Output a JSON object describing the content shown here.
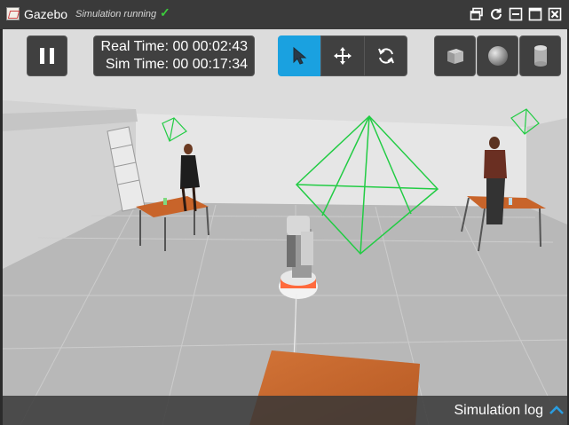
{
  "app": {
    "title": "Gazebo",
    "status": "Simulation running"
  },
  "time": {
    "real_label": "Real Time:",
    "real_value": "00 00:02:43",
    "sim_label": "Sim Time:",
    "sim_value": "00 00:17:34"
  },
  "window_controls": [
    "restore-icon",
    "refresh-icon",
    "minimize-icon",
    "maximize-icon",
    "close-icon"
  ],
  "toolbar": {
    "playback": "pause-icon",
    "tools": [
      "select-arrow-icon",
      "translate-icon",
      "rotate-icon"
    ],
    "active_tool": "select-arrow-icon",
    "shapes": [
      "box-icon",
      "sphere-icon",
      "cylinder-icon"
    ]
  },
  "log": {
    "label": "Simulation log"
  },
  "colors": {
    "accent": "#1aa1e0",
    "check": "#3ccc3c",
    "camera_frustum": "#22cc44",
    "floor": "#b8b8b8",
    "table": "#c8642a"
  }
}
